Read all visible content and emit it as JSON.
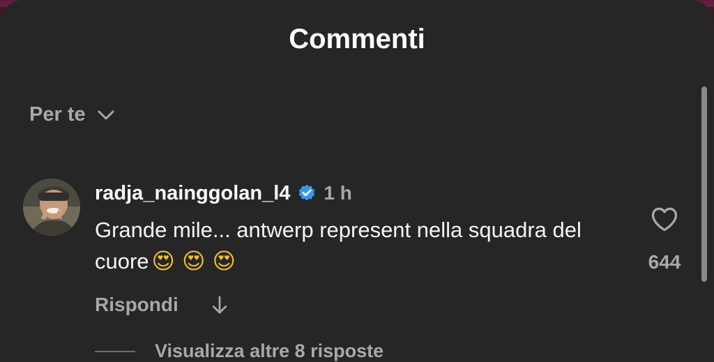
{
  "header": {
    "title": "Commenti"
  },
  "sort": {
    "label": "Per te",
    "icon": "chevron-down-icon"
  },
  "comment": {
    "username": "radja_nainggolan_l4",
    "verified_icon": "verified-badge-icon",
    "time": "1 h",
    "text": "Grande mile... antwerp represent nella squadra del cuore",
    "emojis": "😍 😍 😍",
    "reply_label": "Rispondi",
    "translate_icon": "arrow-down-icon",
    "like_count": "644",
    "like_icon": "heart-outline-icon"
  },
  "replies": {
    "label": "Visualizza altre 8 risposte"
  },
  "colors": {
    "background": "#262626",
    "text_primary": "#ffffff",
    "text_secondary": "#a8a8a8",
    "verified_blue": "#3797f0"
  }
}
